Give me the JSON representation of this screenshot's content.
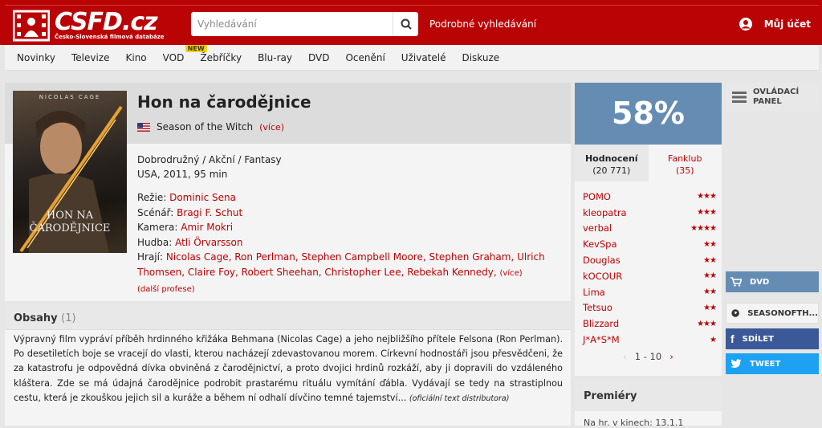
{
  "header": {
    "logo_text": "CSFD.cz",
    "logo_sub": "Česko-Slovenská filmová databáze",
    "search_placeholder": "Vyhledávání",
    "advanced_search": "Podrobné vyhledávání",
    "account": "Můj účet",
    "brand_color": "#ba0305"
  },
  "nav": {
    "items": [
      "Novinky",
      "Televize",
      "Kino",
      "VOD",
      "Žebříčky",
      "Blu-ray",
      "DVD",
      "Ocenění",
      "Uživatelé",
      "Diskuze"
    ],
    "vod_badge": "NEW"
  },
  "film": {
    "title": "Hon na čarodějnice",
    "original_title": "Season of the Witch",
    "original_more": "(více)",
    "genre": "Dobrodružný / Akční / Fantasy",
    "origin": "USA, 2011, 95 min",
    "poster_text_top": "NICOLAS CAGE",
    "poster_title": "HON NA ČARODĚJNICE",
    "directing_label": "Režie:",
    "directing": "Dominic Sena",
    "screenplay_label": "Scénář:",
    "screenplay": "Bragi F. Schut",
    "camera_label": "Kamera:",
    "camera": "Amir Mokri",
    "music_label": "Hudba:",
    "music": "Atli Örvarsson",
    "cast_label": "Hrají:",
    "cast": "Nicolas Cage, Ron Perlman, Stephen Campbell Moore, Stephen Graham, Ulrich Thomsen, Claire Foy, Robert Sheehan, Christopher Lee, Rebekah Kennedy,",
    "cast_more": "(více)",
    "more_professions": "(další profese)"
  },
  "plot": {
    "title": "Obsahy",
    "count": "(1)",
    "text": "Výpravný film vypráví příběh hrdinného křižáka Behmana (Nicolas Cage) a jeho nejbližšího přítele Felsona (Ron Perlman). Po desetiletích boje se vracejí do vlasti, kterou nacházejí zdevastovanou morem. Církevní hodnostáři jsou přesvědčeni, že za katastrofu je odpovědná dívka obviněná z čarodějnictví, a proto dvojici hrdinů rozkáží, aby ji dopravili do vzdáleného kláštera. Zde se má údajná čarodějnice podrobit prastarému rituálu vymítání ďábla. Vydávají se tedy na strastiplnou cestu, která je zkouškou jejich sil a kuráže a během ní odhalí dívčino temné tajemství...",
    "source": "(oficiální text distributora)"
  },
  "rating": {
    "percent": "58%",
    "tab_ratings": "Hodnocení",
    "tab_ratings_count": "(20 771)",
    "tab_fanclub": "Fanklub",
    "tab_fanclub_count": "(35)",
    "users": [
      {
        "name": "POMO",
        "stars": "★★★"
      },
      {
        "name": "kleopatra",
        "stars": "★★★"
      },
      {
        "name": "verbal",
        "stars": "★★★★"
      },
      {
        "name": "KevSpa",
        "stars": "★★"
      },
      {
        "name": "Douglas",
        "stars": "★★"
      },
      {
        "name": "kOCOUR",
        "stars": "★★"
      },
      {
        "name": "Lima",
        "stars": "★★"
      },
      {
        "name": "Tetsuo",
        "stars": "★★"
      },
      {
        "name": "Blizzard",
        "stars": "★★★"
      },
      {
        "name": "J*A*S*M",
        "stars": "★"
      }
    ],
    "pager": "1 - 10"
  },
  "premiery": {
    "title": "Premiéry",
    "text": "Na hr. v kinech: 13.1.1"
  },
  "side": {
    "panel": "OVLÁDACÍ PANEL",
    "dvd": "DVD",
    "site": "SEASONOFTH...",
    "share": "SDÍLET",
    "tweet": "TWEET"
  }
}
